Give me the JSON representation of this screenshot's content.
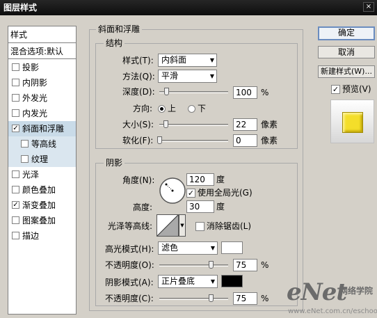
{
  "window": {
    "title": "图层样式",
    "close_label": "×"
  },
  "sidebar": {
    "header": "样式",
    "blend_options": "混合选项:默认",
    "items": [
      {
        "label": "投影",
        "checked": false
      },
      {
        "label": "内阴影",
        "checked": false
      },
      {
        "label": "外发光",
        "checked": false
      },
      {
        "label": "内发光",
        "checked": false
      },
      {
        "label": "斜面和浮雕",
        "checked": true,
        "selected": true
      },
      {
        "label": "等高线",
        "checked": false,
        "sub": true
      },
      {
        "label": "纹理",
        "checked": false,
        "sub": true
      },
      {
        "label": "光泽",
        "checked": false
      },
      {
        "label": "颜色叠加",
        "checked": false
      },
      {
        "label": "渐变叠加",
        "checked": true
      },
      {
        "label": "图案叠加",
        "checked": false
      },
      {
        "label": "描边",
        "checked": false
      }
    ],
    "check_mark": "✓"
  },
  "bevel": {
    "title": "斜面和浮雕",
    "structure": {
      "title": "结构",
      "style_label": "样式(T):",
      "style_value": "内斜面",
      "technique_label": "方法(Q):",
      "technique_value": "平滑",
      "depth_label": "深度(D):",
      "depth_value": "100",
      "depth_unit": "%",
      "depth_level": 0.1,
      "direction_label": "方向:",
      "direction_up": "上",
      "direction_down": "下",
      "direction_selected": "up",
      "size_label": "大小(S):",
      "size_value": "22",
      "size_unit": "像素",
      "size_level": 0.09,
      "soften_label": "软化(F):",
      "soften_value": "0",
      "soften_unit": "像素",
      "soften_level": 0.0
    },
    "shading": {
      "title": "阴影",
      "angle_label": "角度(N):",
      "angle_value": "120",
      "angle_unit": "度",
      "global_light_label": "使用全局光(G)",
      "global_light_checked": true,
      "altitude_label": "高度:",
      "altitude_value": "30",
      "altitude_unit": "度",
      "gloss_label": "光泽等高线:",
      "antialias_label": "消除锯齿(L)",
      "antialias_checked": false,
      "highlight_mode_label": "高光模式(H):",
      "highlight_mode_value": "滤色",
      "highlight_color": "#ffffff",
      "highlight_opacity_label": "不透明度(O):",
      "highlight_opacity_value": "75",
      "highlight_opacity_unit": "%",
      "highlight_opacity_level": 0.75,
      "shadow_mode_label": "阴影模式(A):",
      "shadow_mode_value": "正片叠底",
      "shadow_color": "#000000",
      "shadow_opacity_label": "不透明度(C):",
      "shadow_opacity_value": "75",
      "shadow_opacity_unit": "%",
      "shadow_opacity_level": 0.75
    }
  },
  "buttons": {
    "ok": "确定",
    "cancel": "取消",
    "new_style": "新建样式(W)...",
    "preview_label": "预览(V)",
    "preview_checked": true
  },
  "preview": {
    "swatch_color": "#f4de2a"
  },
  "watermark": {
    "brand": "eNet",
    "brand_cn": "网络学院",
    "url": "www.eNet.com.cn/eschool"
  },
  "icons": {
    "dropdown": "dropdown-arrow-icon"
  }
}
